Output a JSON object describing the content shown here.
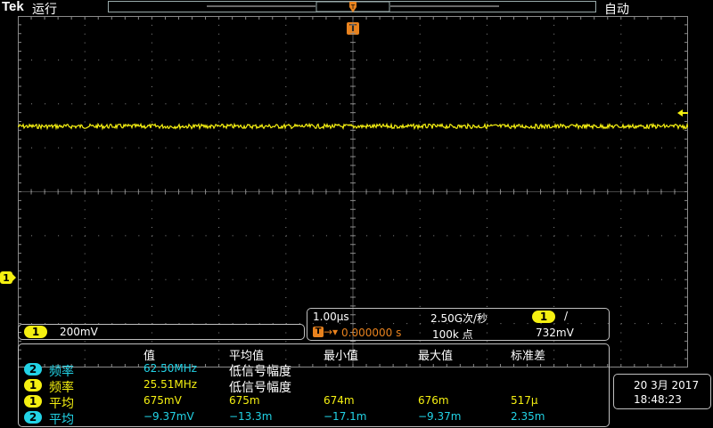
{
  "header": {
    "brand": "Tek",
    "run_state": "运行",
    "trigger_mode": "自动"
  },
  "colors": {
    "ch1": "#f5f011",
    "ch2": "#22d3e6",
    "trigger": "#e8821e",
    "grid": "#8a8a8a"
  },
  "icons": {
    "trigger_position": "trigger-T-icon",
    "ch1_ground": "ch1-reference-arrow-icon",
    "trigger_level": "trigger-level-arrow-icon"
  },
  "channel_scale": {
    "channel": "1",
    "value": "200mV"
  },
  "timebase": {
    "time_per_div": "1.00µs",
    "sample_rate": "2.50G次/秒",
    "trig_channel": "1",
    "trig_slope": "/",
    "trig_delay": "0.000000 s",
    "record_length": "100k 点",
    "trig_level": "732mV"
  },
  "measurements": {
    "headers": [
      "值",
      "平均值",
      "最小值",
      "最大值",
      "标准差"
    ],
    "rows": [
      {
        "channel": "2",
        "name": "频率",
        "value": "62.50MHz",
        "mean": "低信号幅度",
        "min": "",
        "max": "",
        "std": ""
      },
      {
        "channel": "1",
        "name": "频率",
        "value": "25.51MHz",
        "mean": "低信号幅度",
        "min": "",
        "max": "",
        "std": ""
      },
      {
        "channel": "1",
        "name": "平均",
        "value": "675mV",
        "mean": "675m",
        "min": "674m",
        "max": "676m",
        "std": "517µ"
      },
      {
        "channel": "2",
        "name": "平均",
        "value": "−9.37mV",
        "mean": "−13.3m",
        "min": "−17.1m",
        "max": "−9.37m",
        "std": "2.35m"
      }
    ]
  },
  "datetime": {
    "date": "20 3月 2017",
    "time": "18:48:23"
  },
  "ch1_ref_label": "1"
}
